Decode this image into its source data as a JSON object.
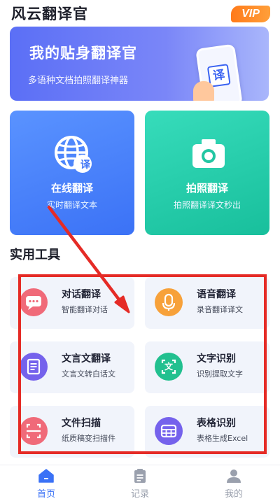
{
  "header": {
    "app_title": "风云翻译官",
    "vip_label": "VIP"
  },
  "banner": {
    "title": "我的贴身翻译官",
    "subtitle": "多语种文档拍照翻译神器",
    "phone_char": "译"
  },
  "features": [
    {
      "title": "在线翻译",
      "subtitle": "实时翻译文本",
      "icon": "globe-translate-icon",
      "badge": "译"
    },
    {
      "title": "拍照翻译",
      "subtitle": "拍照翻译译文秒出",
      "icon": "camera-icon"
    }
  ],
  "tools_section": {
    "title": "实用工具"
  },
  "tools": [
    {
      "title": "对话翻译",
      "subtitle": "智能翻译对话",
      "icon": "chat-bubble-icon",
      "color": "#f06a79"
    },
    {
      "title": "语音翻译",
      "subtitle": "录音翻译译文",
      "icon": "microphone-icon",
      "color": "#f7a13a"
    },
    {
      "title": "文言文翻译",
      "subtitle": "文言文转白话文",
      "icon": "document-icon",
      "color": "#7562ec"
    },
    {
      "title": "文字识别",
      "subtitle": "识别提取文字",
      "icon": "text-scan-icon",
      "color": "#22c08f",
      "icon_char": "文"
    },
    {
      "title": "文件扫描",
      "subtitle": "纸质稿变扫描件",
      "icon": "scan-icon",
      "color": "#f06a79"
    },
    {
      "title": "表格识别",
      "subtitle": "表格生成Excel",
      "icon": "table-icon",
      "color": "#7562ec"
    }
  ],
  "tabbar": {
    "tabs": [
      {
        "label": "首页",
        "icon": "home-icon",
        "active": true
      },
      {
        "label": "记录",
        "icon": "clipboard-icon",
        "active": false
      },
      {
        "label": "我的",
        "icon": "user-icon",
        "active": false
      }
    ]
  },
  "colors": {
    "accent": "#3b72f6",
    "annotation_red": "#e52b26",
    "inactive_tab": "#9aa0ad"
  }
}
